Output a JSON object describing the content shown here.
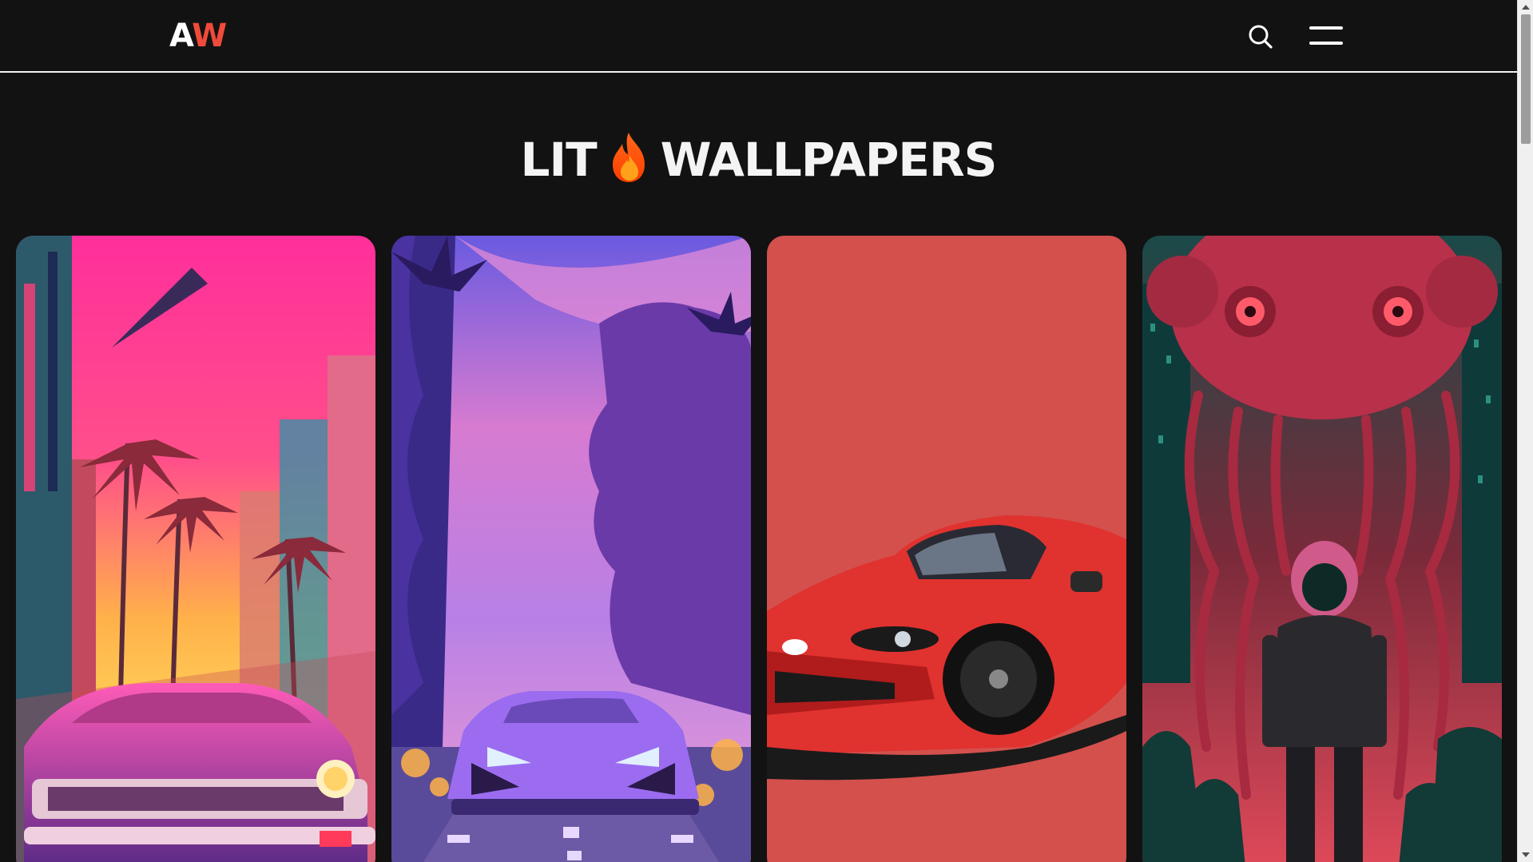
{
  "header": {
    "logo": {
      "part1": "A",
      "part2": "W"
    },
    "search_icon": "search-icon",
    "menu_icon": "hamburger-menu-icon"
  },
  "page": {
    "title_part1": "LIT",
    "title_icon": "fire-icon",
    "title_part2": "WALLPAPERS"
  },
  "wallpapers": [
    {
      "subject": "retro car on neon palm street",
      "colors": [
        "#ff3f9a",
        "#ffb347",
        "#5b2a86"
      ]
    },
    {
      "subject": "purple supercar on palm road",
      "colors": [
        "#8a5cf0",
        "#e27cc5",
        "#3a2a7a"
      ]
    },
    {
      "subject": "red roadster on red background",
      "colors": [
        "#d3504d",
        "#e0322f",
        "#1a1a1a"
      ]
    },
    {
      "subject": "giant octopus over astronaut",
      "colors": [
        "#e14a5a",
        "#164a45",
        "#2a2a2a"
      ]
    }
  ],
  "colors": {
    "background": "#121212",
    "logo_accent": "#f04a3b",
    "text": "#f4f4f4"
  }
}
